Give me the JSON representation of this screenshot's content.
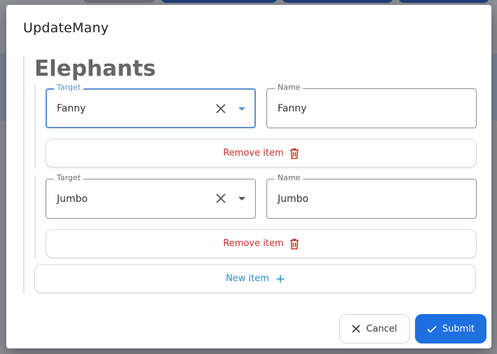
{
  "dialog": {
    "title": "UpdateMany",
    "section_heading": "Elephants",
    "items": [
      {
        "target_label": "Target",
        "target_value": "Fanny",
        "name_label": "Name",
        "name_value": "Fanny",
        "remove_label": "Remove item"
      },
      {
        "target_label": "Target",
        "target_value": "Jumbo",
        "name_label": "Name",
        "name_value": "Jumbo",
        "remove_label": "Remove item"
      }
    ],
    "new_item_label": "New item",
    "cancel_label": "Cancel",
    "submit_label": "Submit"
  },
  "colors": {
    "focus": "#5b8fd6",
    "danger": "#c9302c",
    "link": "#2a8fc7",
    "primary": "#1e6fe0"
  },
  "icons": {
    "clear": "close-icon",
    "dropdown": "caret-down-icon",
    "remove": "trash-icon",
    "new": "plus-icon",
    "cancel": "close-icon",
    "submit": "check-icon"
  }
}
